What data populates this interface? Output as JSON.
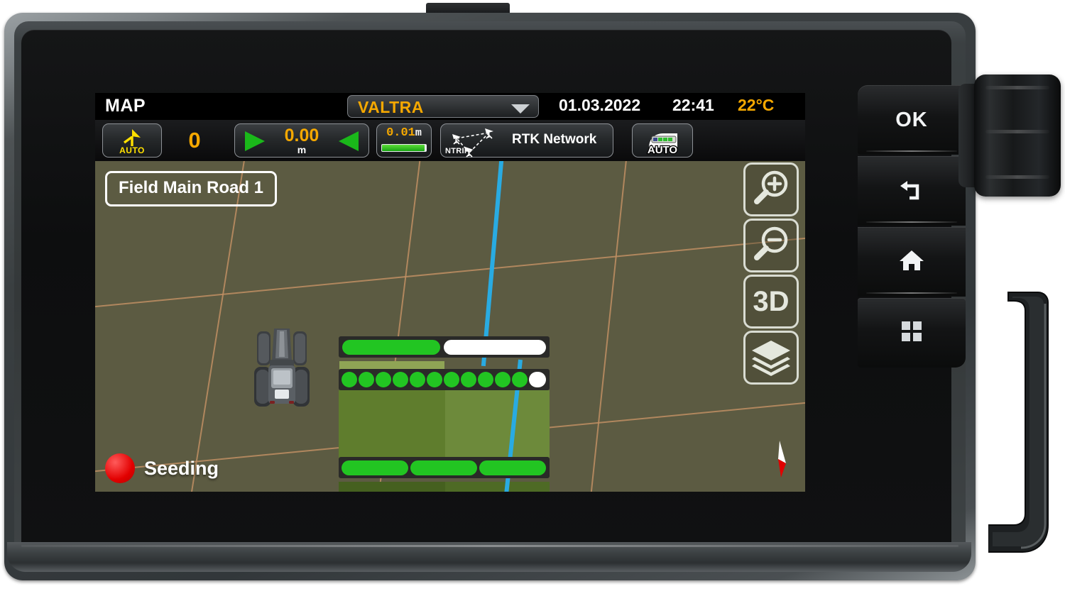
{
  "device": {
    "name": "valtra-smarttouch-terminal",
    "hard_buttons": [
      {
        "name": "ok-button",
        "label": "OK",
        "icon": null
      },
      {
        "name": "back-button",
        "label": "",
        "icon": "back-arrow-icon"
      },
      {
        "name": "home-button",
        "label": "",
        "icon": "home-icon"
      },
      {
        "name": "apps-button",
        "label": "",
        "icon": "grid-apps-icon"
      }
    ],
    "rotary_knob": {
      "name": "rotary-knob"
    },
    "mount_handle": {
      "name": "mount-bracket"
    }
  },
  "screen": {
    "titlebar": {
      "page_title": "MAP",
      "vehicle": "VALTRA",
      "vehicle_dropdown_icon": "chevron-down-icon",
      "date": "01.03.2022",
      "time": "22:41",
      "temperature": "22°C"
    },
    "statusbar": {
      "steering": {
        "label": "AUTO",
        "icon": "auto-steering-icon"
      },
      "heading": {
        "value": "0"
      },
      "deviation": {
        "value": "0.00",
        "unit": "m",
        "left_icon": "arrow-left-icon",
        "right_icon": "arrow-right-icon"
      },
      "accuracy": {
        "value": "0.01",
        "unit": "m",
        "bar_percent": 96
      },
      "correction": {
        "label": "RTK Network",
        "sublabel": "NTRIP",
        "icon": "ntrip-satellite-icon"
      },
      "implement": {
        "label": "AUTO",
        "icon": "implement-auto-sections-icon"
      }
    },
    "map": {
      "field_label": "Field Main Road 1",
      "task_status": {
        "label": "Seeding",
        "color": "#e20000"
      },
      "compass": {
        "name": "compass-north-icon"
      },
      "guidance_line_color": "#29abe2",
      "grid_color": "#c08f63",
      "background_color": "#5c5b42",
      "worked_color": "#4f6b28",
      "section_on_color": "#22c522",
      "section_off_color": "#ffffff",
      "controls": [
        {
          "name": "zoom-in-button",
          "label": "",
          "icon": "magnifier-plus-icon"
        },
        {
          "name": "zoom-out-button",
          "label": "",
          "icon": "magnifier-minus-icon"
        },
        {
          "name": "view-3d-button",
          "label": "3D",
          "icon": null
        },
        {
          "name": "layers-button",
          "label": "",
          "icon": "layers-icon"
        }
      ],
      "section_bars": [
        {
          "name": "front-section-bar",
          "segments": [
            "on",
            "off"
          ]
        },
        {
          "name": "seeding-section-bar",
          "segments": [
            "on",
            "on",
            "on",
            "on",
            "on",
            "on",
            "on",
            "on",
            "on",
            "on",
            "on",
            "off"
          ]
        },
        {
          "name": "rear-section-bar",
          "segments": [
            "on",
            "on",
            "on"
          ]
        }
      ]
    }
  }
}
